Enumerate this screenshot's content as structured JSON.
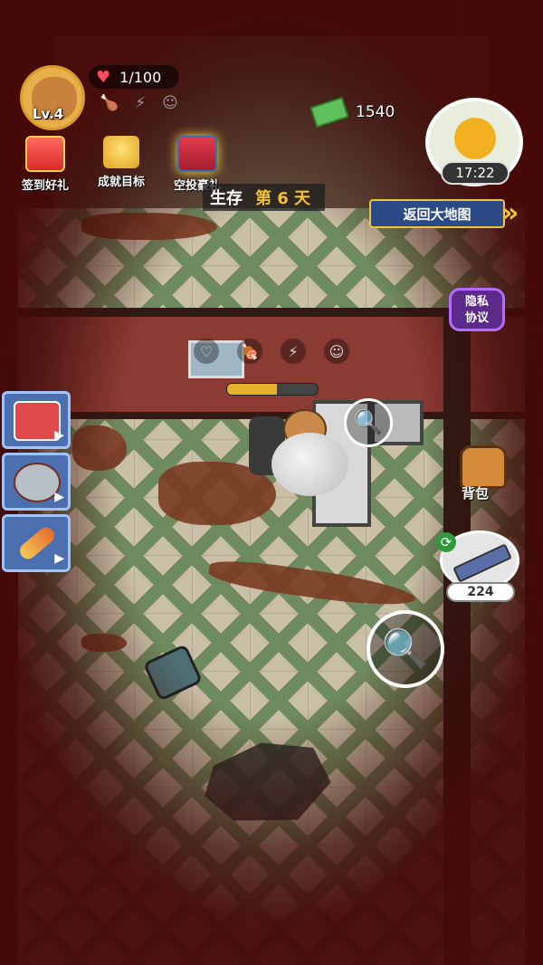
{
  "player": {
    "level": "Lv.4",
    "hp": "1/100"
  },
  "status_icons": [
    "hunger-icon",
    "energy-icon",
    "mood-icon"
  ],
  "rewards": [
    {
      "label": "签到好礼",
      "icon": "gift-box-icon"
    },
    {
      "label": "成就目标",
      "icon": "trophy-icon"
    },
    {
      "label": "空投豪礼",
      "icon": "airdrop-crate-icon"
    }
  ],
  "money": "1540",
  "clock": {
    "time": "17:22",
    "weather_icon": "sun-icon"
  },
  "survival": {
    "prefix": "生存",
    "day": "第 6 天"
  },
  "return_button": {
    "label": "返回大地图"
  },
  "privacy_button": {
    "line1": "隐私",
    "line2": "协议"
  },
  "quick_items": [
    {
      "name": "medkit",
      "icon": "medkit-icon"
    },
    {
      "name": "canned-food",
      "icon": "canned-food-icon"
    },
    {
      "name": "vial",
      "icon": "vial-icon"
    }
  ],
  "backpack": {
    "label": "背包"
  },
  "weapon": {
    "ammo": "224",
    "icon": "rifle-icon"
  },
  "action_progress": 0.55,
  "colors": {
    "hud_gold": "#f3c12e",
    "button_blue": "#2c4a86",
    "privacy_purple": "#5b2a8a",
    "hp_red": "#ff4b5c"
  }
}
